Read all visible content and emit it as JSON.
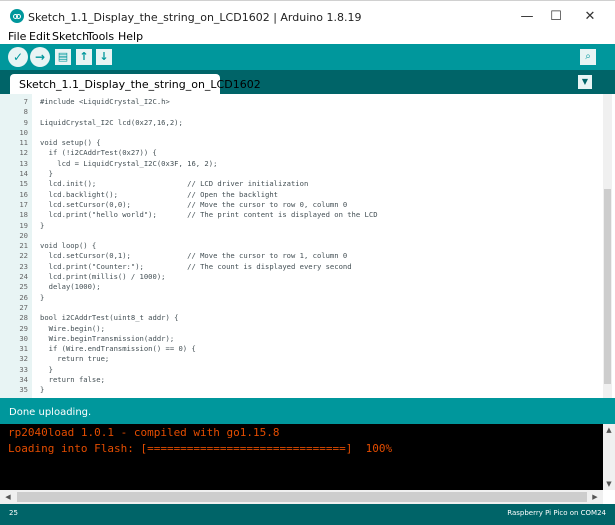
{
  "window": {
    "title": "Sketch_1.1_Display_the_string_on_LCD1602 | Arduino 1.8.19",
    "minimize_glyph": "—",
    "maximize_glyph": "☐",
    "close_glyph": "✕"
  },
  "menu": [
    "File",
    "Edit",
    "Sketch",
    "Tools",
    "Help"
  ],
  "toolbar": {
    "icons": [
      "verify-icon",
      "upload-icon",
      "new-icon",
      "open-icon",
      "save-icon",
      "serial-monitor-icon"
    ],
    "verify_glyph": "✓",
    "upload_glyph": "→",
    "new_glyph": "▤",
    "open_glyph": "↑",
    "save_glyph": "↓",
    "serial_glyph": "⌕"
  },
  "tabs": {
    "active": "Sketch_1.1_Display_the_string_on_LCD1602",
    "menu_glyph": "▼"
  },
  "code_lines": [
    {
      "n": "7",
      "text": "#include <LiquidCrystal_I2C.h>"
    },
    {
      "n": "8",
      "text": ""
    },
    {
      "n": "9",
      "text": "LiquidCrystal_I2C lcd(0x27,16,2);"
    },
    {
      "n": "10",
      "text": ""
    },
    {
      "n": "11",
      "text": "void setup() {"
    },
    {
      "n": "12",
      "text": "  if (!i2CAddrTest(0x27)) {"
    },
    {
      "n": "13",
      "text": "    lcd = LiquidCrystal_I2C(0x3F, 16, 2);"
    },
    {
      "n": "14",
      "text": "  }"
    },
    {
      "n": "15",
      "text": "  lcd.init();                     // LCD driver initialization"
    },
    {
      "n": "16",
      "text": "  lcd.backlight();                // Open the backlight"
    },
    {
      "n": "17",
      "text": "  lcd.setCursor(0,0);             // Move the cursor to row 0, column 0"
    },
    {
      "n": "18",
      "text": "  lcd.print(\"hello world\");       // The print content is displayed on the LCD"
    },
    {
      "n": "19",
      "text": "}"
    },
    {
      "n": "20",
      "text": ""
    },
    {
      "n": "21",
      "text": "void loop() {"
    },
    {
      "n": "22",
      "text": "  lcd.setCursor(0,1);             // Move the cursor to row 1, column 0"
    },
    {
      "n": "23",
      "text": "  lcd.print(\"Counter:\");          // The count is displayed every second"
    },
    {
      "n": "24",
      "text": "  lcd.print(millis() / 1000);"
    },
    {
      "n": "25",
      "text": "  delay(1000);"
    },
    {
      "n": "26",
      "text": "}"
    },
    {
      "n": "27",
      "text": ""
    },
    {
      "n": "28",
      "text": "bool i2CAddrTest(uint8_t addr) {"
    },
    {
      "n": "29",
      "text": "  Wire.begin();"
    },
    {
      "n": "30",
      "text": "  Wire.beginTransmission(addr);"
    },
    {
      "n": "31",
      "text": "  if (Wire.endTransmission() == 0) {"
    },
    {
      "n": "32",
      "text": "    return true;"
    },
    {
      "n": "33",
      "text": "  }"
    },
    {
      "n": "34",
      "text": "  return false;"
    },
    {
      "n": "35",
      "text": "}"
    }
  ],
  "status": {
    "message": "Done uploading."
  },
  "console": {
    "lines": [
      "rp2040load 1.0.1 - compiled with go1.15.8",
      "Loading into Flash: [==============================]  100%"
    ],
    "up_arrow": "▲",
    "down_arrow": "▼",
    "left_arrow": "◀",
    "right_arrow": "▶"
  },
  "footer": {
    "line_number": "25",
    "board": "Raspberry Pi Pico on COM24"
  },
  "colors": {
    "teal": "#00979c",
    "dark_teal": "#006468",
    "console_text": "#e34c00"
  }
}
